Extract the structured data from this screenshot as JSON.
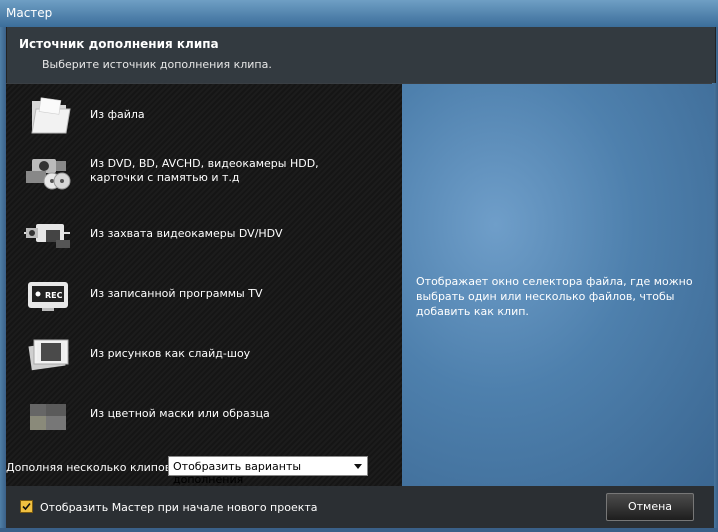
{
  "window": {
    "title": "Мастер"
  },
  "header": {
    "title": "Источник дополнения клипа",
    "subtitle": "Выберите источник дополнения клипа."
  },
  "sources": [
    {
      "label": "Из файла",
      "icon": "folder-icon"
    },
    {
      "label": "Из DVD, BD, AVCHD, видеокамеры HDD, карточки с памятью и т.д",
      "icon": "camera-disc-icon"
    },
    {
      "label": "Из захвата видеокамеры DV/HDV",
      "icon": "dv-camera-icon"
    },
    {
      "label": "Из записанной программы TV",
      "icon": "tv-rec-icon"
    },
    {
      "label": "Из рисунков как слайд-шоу",
      "icon": "slideshow-icon"
    },
    {
      "label": "Из цветной маски или образца",
      "icon": "color-mask-icon"
    }
  ],
  "description": "Отображает окно селектора файла, где можно выбрать один или несколько файлов, чтобы добавить как клип.",
  "add_multiple": {
    "label": "Дополняя несколько клипов:",
    "selected": "Отобразить варианты дополнения"
  },
  "footer": {
    "checkbox_label": "Отобразить Мастер при начале нового проекта",
    "checkbox_checked": true,
    "cancel_label": "Отмена"
  }
}
